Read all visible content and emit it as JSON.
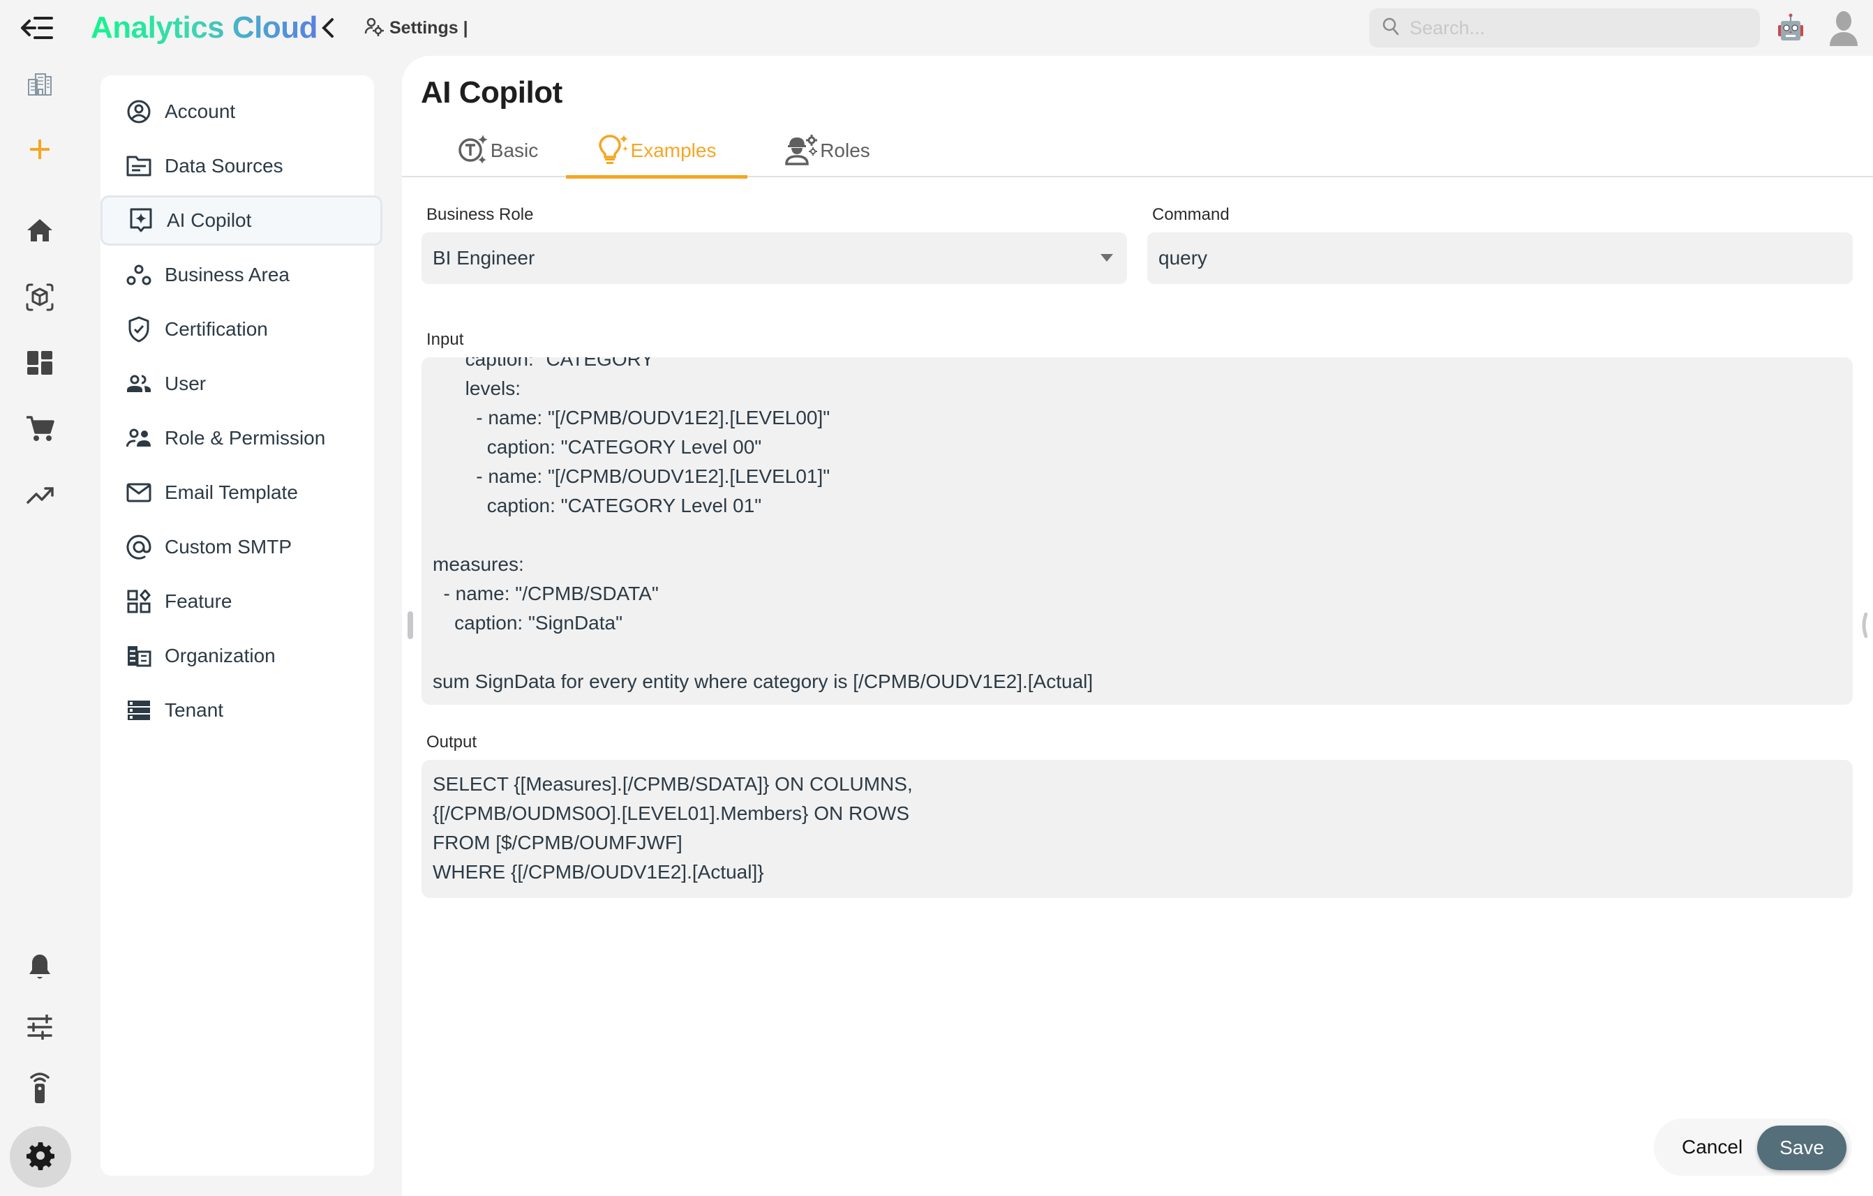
{
  "app": {
    "title": "Analytics Cloud",
    "breadcrumb": "Settings |",
    "search_placeholder": "Search..."
  },
  "rail": {
    "icons": [
      "buildings-icon",
      "plus-icon",
      "home-icon",
      "cube-scan-icon",
      "dashboard-icon",
      "cart-icon",
      "trending-up-icon",
      "bell-icon",
      "sliders-icon",
      "remote-icon",
      "gear-icon"
    ],
    "accent_color": "#f5a623"
  },
  "sidebar": {
    "items": [
      {
        "label": "Account",
        "icon": "account-circle-icon"
      },
      {
        "label": "Data Sources",
        "icon": "folder-icon"
      },
      {
        "label": "AI Copilot",
        "icon": "ai-sparkle-icon",
        "active": true
      },
      {
        "label": "Business Area",
        "icon": "workspaces-icon"
      },
      {
        "label": "Certification",
        "icon": "shield-check-icon"
      },
      {
        "label": "User",
        "icon": "users-icon"
      },
      {
        "label": "Role & Permission",
        "icon": "role-icon"
      },
      {
        "label": "Email Template",
        "icon": "mail-icon"
      },
      {
        "label": "Custom SMTP",
        "icon": "at-sign-icon"
      },
      {
        "label": "Feature",
        "icon": "widgets-icon"
      },
      {
        "label": "Organization",
        "icon": "organization-icon"
      },
      {
        "label": "Tenant",
        "icon": "server-icon"
      }
    ]
  },
  "main": {
    "title": "AI Copilot",
    "tabs": [
      {
        "label": "Basic",
        "icon": "text-sparkle-icon",
        "active": false
      },
      {
        "label": "Examples",
        "icon": "lightbulb-sparkle-icon",
        "active": true
      },
      {
        "label": "Roles",
        "icon": "engineer-gear-icon",
        "active": false
      }
    ],
    "business_role": {
      "label": "Business Role",
      "value": "BI Engineer"
    },
    "command": {
      "label": "Command",
      "value": "query"
    },
    "input": {
      "label": "Input",
      "lines": [
        "      caption: \"CATEGORY\"",
        "      levels:",
        "        - name: \"[/CPMB/OUDV1E2].[LEVEL00]\"",
        "          caption: \"CATEGORY Level 00\"",
        "        - name: \"[/CPMB/OUDV1E2].[LEVEL01]\"",
        "          caption: \"CATEGORY Level 01\"",
        "",
        "measures:",
        "  - name: \"/CPMB/SDATA\"",
        "    caption: \"SignData\"",
        "",
        "sum SignData for every entity where category is [/CPMB/OUDV1E2].[Actual]"
      ]
    },
    "output": {
      "label": "Output",
      "lines": [
        "SELECT {[Measures].[/CPMB/SDATA]} ON COLUMNS,",
        "{[/CPMB/OUDMS0O].[LEVEL01].Members} ON ROWS",
        "FROM [$/CPMB/OUMFJWF]",
        "WHERE {[/CPMB/OUDV1E2].[Actual]}"
      ]
    },
    "actions": {
      "cancel": "Cancel",
      "save": "Save"
    },
    "colors": {
      "save_button": "#546e7a",
      "active_tab": "#f5a623"
    }
  }
}
